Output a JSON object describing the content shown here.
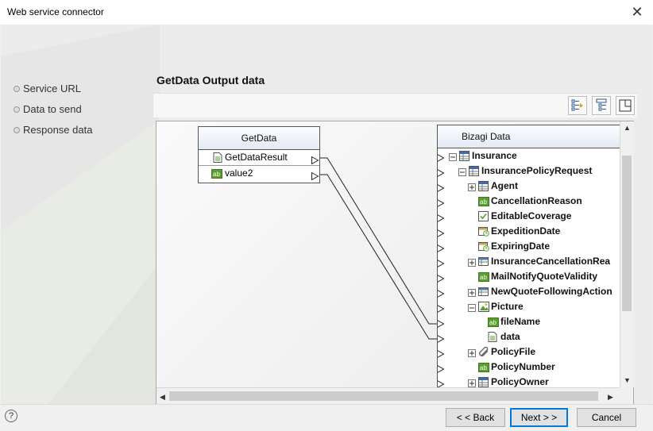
{
  "window": {
    "title": "Web service connector"
  },
  "steps": [
    {
      "label": "Service URL"
    },
    {
      "label": "Data to send"
    },
    {
      "label": "Response data"
    }
  ],
  "heading": "GetData Output data",
  "toolbar": {
    "icons": [
      "map-left-icon",
      "map-right-icon",
      "layout-icon"
    ]
  },
  "source": {
    "title": "GetData",
    "rows": [
      {
        "label": "GetDataResult",
        "icon": "document-icon"
      },
      {
        "label": "value2",
        "icon": "string-attribute-icon"
      }
    ]
  },
  "target": {
    "title": "Bizagi Data",
    "rows": [
      {
        "label": "Insurance",
        "icon": "entity-icon",
        "level": 0,
        "expander": "minus"
      },
      {
        "label": "InsurancePolicyRequest",
        "icon": "entity-icon",
        "level": 1,
        "expander": "minus"
      },
      {
        "label": "Agent",
        "icon": "entity-icon",
        "level": 2,
        "expander": "plus"
      },
      {
        "label": "CancellationReason",
        "icon": "string-attribute-icon",
        "level": 2,
        "expander": "none"
      },
      {
        "label": "EditableCoverage",
        "icon": "boolean-icon",
        "level": 2,
        "expander": "none"
      },
      {
        "label": "ExpeditionDate",
        "icon": "date-icon",
        "level": 2,
        "expander": "none"
      },
      {
        "label": "ExpiringDate",
        "icon": "date-icon",
        "level": 2,
        "expander": "none"
      },
      {
        "label": "InsuranceCancellationRea",
        "icon": "collection-icon",
        "level": 2,
        "expander": "plus"
      },
      {
        "label": "MailNotifyQuoteValidity",
        "icon": "string-attribute-icon",
        "level": 2,
        "expander": "none"
      },
      {
        "label": "NewQuoteFollowingAction",
        "icon": "collection-icon",
        "level": 2,
        "expander": "plus"
      },
      {
        "label": "Picture",
        "icon": "image-icon",
        "level": 2,
        "expander": "minus"
      },
      {
        "label": "fileName",
        "icon": "string-attribute-icon",
        "level": 3,
        "expander": "none"
      },
      {
        "label": "data",
        "icon": "document-icon",
        "level": 3,
        "expander": "none"
      },
      {
        "label": "PolicyFile",
        "icon": "attachment-icon",
        "level": 2,
        "expander": "plus"
      },
      {
        "label": "PolicyNumber",
        "icon": "string-attribute-icon",
        "level": 2,
        "expander": "none"
      },
      {
        "label": "PolicyOwner",
        "icon": "entity-icon",
        "level": 2,
        "expander": "plus"
      }
    ]
  },
  "buttons": {
    "back": "< < Back",
    "next": "Next > >",
    "cancel": "Cancel"
  },
  "colors": {
    "accent": "#0078d7",
    "attr_green": "#5a9e2f",
    "entity_blue": "#3b6db3"
  }
}
